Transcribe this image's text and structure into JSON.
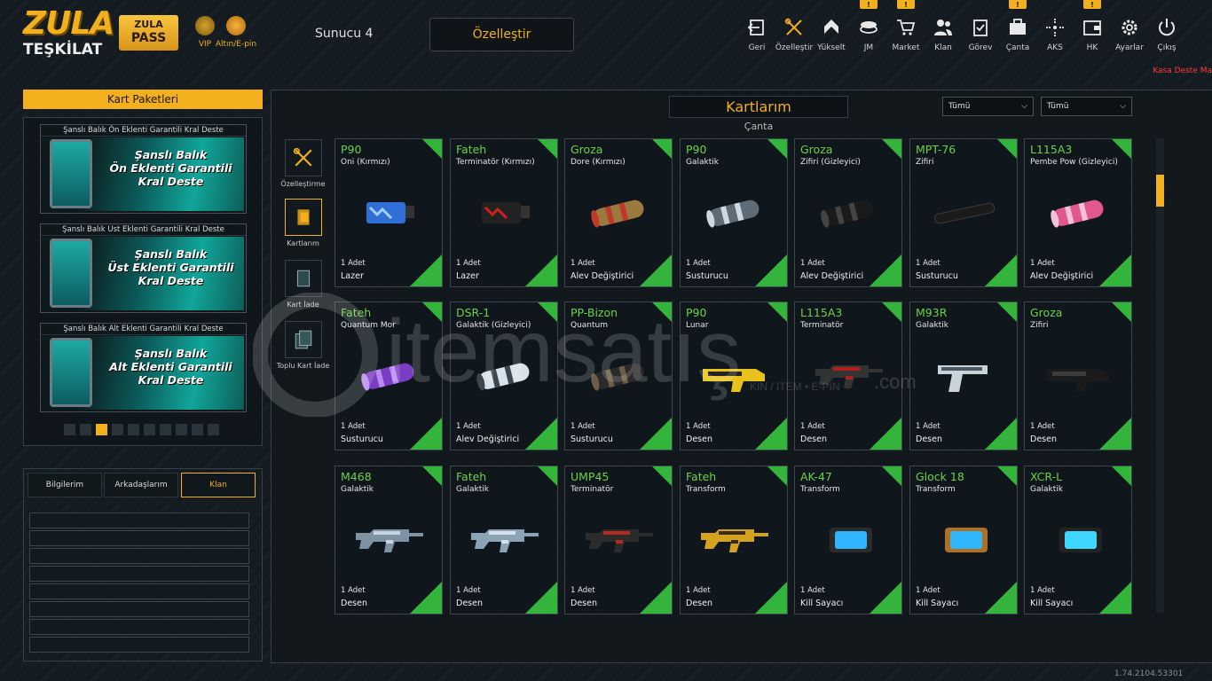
{
  "header": {
    "logo_top": "ZULA",
    "logo_bottom": "TEŞKİLAT",
    "pass_line1": "ZULA",
    "pass_line2": "PASS",
    "vip_label": "VIP",
    "epin_label": "Altın/E-pin",
    "server": "Sunucu 4",
    "customize_button": "Özelleştir"
  },
  "nav": [
    {
      "label": "Geri",
      "icon": "back-icon",
      "notif": ""
    },
    {
      "label": "Özelleştir",
      "icon": "tools-icon",
      "notif": ""
    },
    {
      "label": "Yükselt",
      "icon": "upgrade-icon",
      "notif": ""
    },
    {
      "label": "JM",
      "icon": "coins-icon",
      "notif": "!"
    },
    {
      "label": "Market",
      "icon": "cart-icon",
      "notif": "!"
    },
    {
      "label": "Klan",
      "icon": "clan-icon",
      "notif": ""
    },
    {
      "label": "Görev",
      "icon": "clipboard-icon",
      "notif": ""
    },
    {
      "label": "Çanta",
      "icon": "bag-icon",
      "notif": "!"
    },
    {
      "label": "AKS",
      "icon": "crosshair-icon",
      "notif": ""
    },
    {
      "label": "HK",
      "icon": "wallet-icon",
      "notif": "!"
    },
    {
      "label": "Ayarlar",
      "icon": "gear-icon",
      "notif": ""
    },
    {
      "label": "Çıkış",
      "icon": "power-icon",
      "notif": ""
    }
  ],
  "kasa_text": "Kasa Deste Ma",
  "left": {
    "title": "Kart Paketleri",
    "decks": [
      {
        "header": "Şanslı Balık Ön Eklenti Garantili Kral Deste",
        "art_text": "Şanslı Balık\nÖn Eklenti Garantili\nKral Deste"
      },
      {
        "header": "Şanslı Balık Ust Eklenti Garantili Kral Deste",
        "art_text": "Şanslı Balık\nÜst Eklenti Garantili\nKral Deste"
      },
      {
        "header": "Şanslı Balık Alt Eklenti Garantili Kral Deste",
        "art_text": "Şanslı Balık\nAlt Eklenti Garantili\nKral Deste"
      }
    ],
    "page_count": 10,
    "active_page": 3,
    "social_tabs": [
      "Bilgilerim",
      "Arkadaşlarım",
      "Klan"
    ],
    "active_social_tab": 2
  },
  "main": {
    "title": "Kartlarım",
    "subtitle": "Çanta",
    "filter1": "Tümü",
    "filter2": "Tümü",
    "side": [
      {
        "label": "Özelleştirme",
        "icon": "tools-icon"
      },
      {
        "label": "Kartlarım",
        "icon": "cards-icon"
      },
      {
        "label": "Kart İade",
        "icon": "card-return-icon"
      },
      {
        "label": "Toplu Kart İade",
        "icon": "bulk-card-return-icon"
      }
    ],
    "cards": [
      {
        "weapon": "P90",
        "skin": "Oni (Kırmızı)",
        "qty": "1 Adet",
        "type": "Lazer",
        "kind": "laser",
        "c1": "#2f6fd6",
        "c2": "#9fd0ff"
      },
      {
        "weapon": "Fateh",
        "skin": "Terminatör (Kırmızı)",
        "qty": "1 Adet",
        "type": "Lazer",
        "kind": "laser",
        "c1": "#222",
        "c2": "#d01f1f"
      },
      {
        "weapon": "Groza",
        "skin": "Dore (Kırmızı)",
        "qty": "1 Adet",
        "type": "Alev Değiştirici",
        "kind": "tube",
        "c1": "#9b7a3f",
        "c2": "#c0392b"
      },
      {
        "weapon": "P90",
        "skin": "Galaktik",
        "qty": "1 Adet",
        "type": "Susturucu",
        "kind": "tube",
        "c1": "#5d6b77",
        "c2": "#cfd8de"
      },
      {
        "weapon": "Groza",
        "skin": "Zifiri (Gizleyici)",
        "qty": "1 Adet",
        "type": "Alev Değiştirici",
        "kind": "tube",
        "c1": "#1a1a1a",
        "c2": "#444"
      },
      {
        "weapon": "MPT-76",
        "skin": "Zifiri",
        "qty": "1 Adet",
        "type": "Susturucu",
        "kind": "thin",
        "c1": "#1a1a1a",
        "c2": "#3a3a3a"
      },
      {
        "weapon": "L115A3",
        "skin": "Pembe Pow (Gizleyici)",
        "qty": "1 Adet",
        "type": "Alev Değiştirici",
        "kind": "tube",
        "c1": "#e0588f",
        "c2": "#f4c2d6"
      },
      {
        "weapon": "Fateh",
        "skin": "Quantum Mor",
        "qty": "1 Adet",
        "type": "Susturucu",
        "kind": "tube",
        "c1": "#7a3dc4",
        "c2": "#b98af0"
      },
      {
        "weapon": "DSR-1",
        "skin": "Galaktik (Gizleyici)",
        "qty": "1 Adet",
        "type": "Alev Değiştirici",
        "kind": "tube",
        "c1": "#d9e2e8",
        "c2": "#3a4650"
      },
      {
        "weapon": "PP-Bizon",
        "skin": "Quantum",
        "qty": "1 Adet",
        "type": "Susturucu",
        "kind": "tube",
        "c1": "#2a2a2a",
        "c2": "#6b5d46"
      },
      {
        "weapon": "P90",
        "skin": "Lunar",
        "qty": "1 Adet",
        "type": "Desen",
        "kind": "gun",
        "c1": "#e8c21a",
        "c2": "#222"
      },
      {
        "weapon": "L115A3",
        "skin": "Terminatör",
        "qty": "1 Adet",
        "type": "Desen",
        "kind": "rifle",
        "c1": "#333",
        "c2": "#b02020"
      },
      {
        "weapon": "M93R",
        "skin": "Galaktik",
        "qty": "1 Adet",
        "type": "Desen",
        "kind": "pistol",
        "c1": "#c9d3da",
        "c2": "#4b5863"
      },
      {
        "weapon": "Groza",
        "skin": "Zifiri",
        "qty": "1 Adet",
        "type": "Desen",
        "kind": "gun",
        "c1": "#1b1b1b",
        "c2": "#3d3d3d"
      },
      {
        "weapon": "M468",
        "skin": "Galaktik",
        "qty": "1 Adet",
        "type": "Desen",
        "kind": "rifle",
        "c1": "#7d93a4",
        "c2": "#c5d5e0"
      },
      {
        "weapon": "Fateh",
        "skin": "Galaktik",
        "qty": "1 Adet",
        "type": "Desen",
        "kind": "rifle",
        "c1": "#8aa4b6",
        "c2": "#d5e2ea"
      },
      {
        "weapon": "UMP45",
        "skin": "Terminatör",
        "qty": "1 Adet",
        "type": "Desen",
        "kind": "rifle",
        "c1": "#2b2b2b",
        "c2": "#b52a1f"
      },
      {
        "weapon": "Fateh",
        "skin": "Transform",
        "qty": "1 Adet",
        "type": "Desen",
        "kind": "rifle",
        "c1": "#d4a21d",
        "c2": "#3a2a1a"
      },
      {
        "weapon": "AK-47",
        "skin": "Transform",
        "qty": "1 Adet",
        "type": "Kill Sayacı",
        "kind": "counter",
        "c1": "#2fb6ff",
        "c2": "#2b2b2b"
      },
      {
        "weapon": "Glock 18",
        "skin": "Transform",
        "qty": "1 Adet",
        "type": "Kill Sayacı",
        "kind": "counter",
        "c1": "#2fb6ff",
        "c2": "#b07020"
      },
      {
        "weapon": "XCR-L",
        "skin": "Galaktik",
        "qty": "1 Adet",
        "type": "Kill Sayacı",
        "kind": "counter",
        "c1": "#3fd6ff",
        "c2": "#222"
      }
    ]
  },
  "watermark": {
    "brand": "itemsatış",
    "sub": "KIN / ITEM • E-PIN",
    "tld": ".com"
  },
  "version": "1.74.2104.53301",
  "colors": {
    "accent": "#f2b01e",
    "rarity_green": "#34b43a",
    "weapon_name": "#6ed04a",
    "kasa_red": "#ff3b3b"
  }
}
